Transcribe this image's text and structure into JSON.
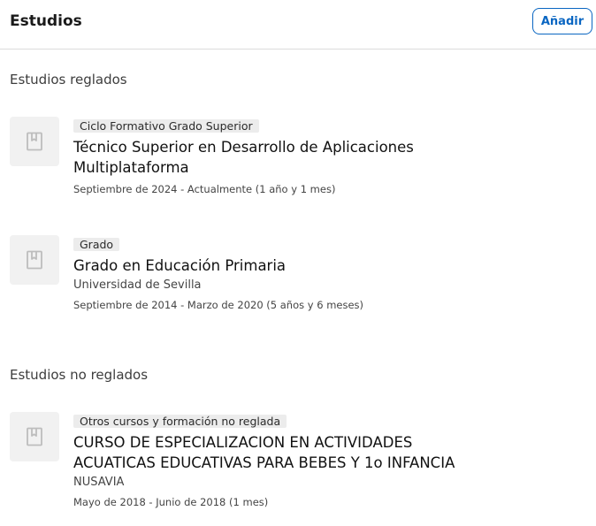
{
  "header": {
    "title": "Estudios",
    "add_label": "Añadir"
  },
  "sections": [
    {
      "title": "Estudios reglados",
      "entries": [
        {
          "icon": "book-icon",
          "badge": "Ciclo Formativo Grado Superior",
          "title": "Técnico Superior en Desarrollo de Aplicaciones Multiplataforma",
          "org": "",
          "dates": "Septiembre de 2024 - Actualmente (1 año y 1 mes)"
        },
        {
          "icon": "book-icon",
          "badge": "Grado",
          "title": "Grado en Educación Primaria",
          "org": "Universidad de Sevilla",
          "dates": "Septiembre de 2014 - Marzo de 2020 (5 años y 6 meses)"
        }
      ]
    },
    {
      "title": "Estudios no reglados",
      "entries": [
        {
          "icon": "book-icon",
          "badge": "Otros cursos y formación no reglada",
          "title": "CURSO DE ESPECIALIZACION EN ACTIVIDADES ACUATICAS EDUCATIVAS PARA BEBES Y 1o INFANCIA",
          "org": "NUSAVIA",
          "dates": "Mayo de 2018 - Junio de 2018 (1 mes)"
        }
      ]
    }
  ],
  "colors": {
    "accent": "#0a66c2",
    "badge_bg": "#ececec",
    "thumb_bg": "#f1f1f1",
    "divider": "#dcdcdc"
  }
}
